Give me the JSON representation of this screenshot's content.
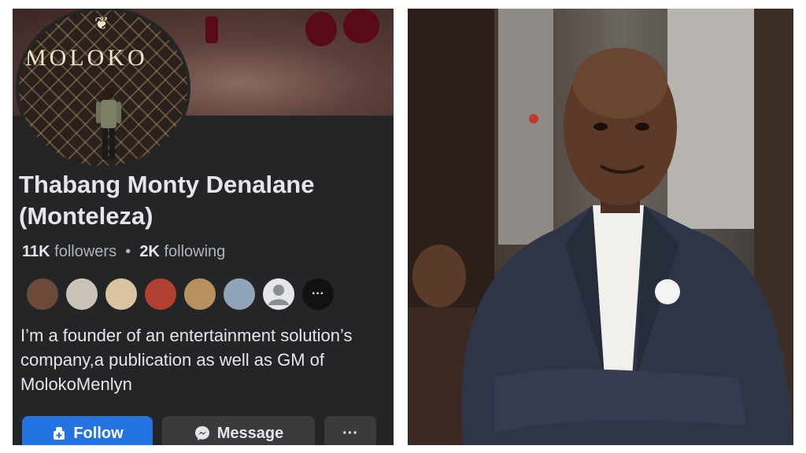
{
  "profile": {
    "cover_brand": "MOLOKO",
    "name": "Thabang Monty Denalane (Monteleza)",
    "followers_count": "11K",
    "followers_label": " followers",
    "separator": "  •  ",
    "following_count": "2K",
    "following_label": " following",
    "bio": "I’m a founder of an entertainment solution’s company,a publication as well as GM of MolokoMenlyn"
  },
  "friends": [
    {
      "icon": "friend-avatar",
      "color": "#6b4a3a"
    },
    {
      "icon": "friend-avatar",
      "color": "#c8c2b8"
    },
    {
      "icon": "friend-avatar",
      "color": "#d9c3a0"
    },
    {
      "icon": "friend-avatar",
      "color": "#b24030"
    },
    {
      "icon": "friend-avatar",
      "color": "#b89060"
    },
    {
      "icon": "friend-avatar",
      "color": "#8fa4b8"
    },
    {
      "icon": "default-avatar-icon",
      "color": "#e4e6eb"
    },
    {
      "icon": "more-friends-icon",
      "color": "#111111"
    }
  ],
  "actions": {
    "follow_label": "Follow",
    "message_label": "Message",
    "more_label": "···"
  },
  "colors": {
    "panel_bg": "#242526",
    "accent": "#2374e1",
    "button_gray": "#3a3b3c"
  }
}
